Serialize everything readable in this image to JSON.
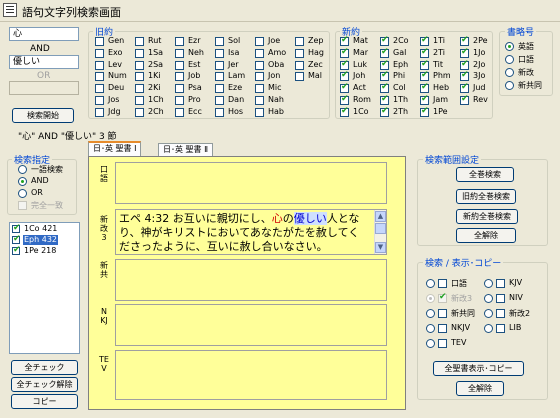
{
  "window": {
    "title": "語句文字列検索画面"
  },
  "search": {
    "term1": "心",
    "op1": "AND",
    "term2": "優しい",
    "op2": "OR",
    "term3": "",
    "start_button": "検索開始",
    "result_summary": "\"心\" AND \"優しい\" 3 節"
  },
  "old_testament": {
    "title": "旧約",
    "columns": [
      [
        {
          "label": "Gen",
          "checked": false
        },
        {
          "label": "Exo",
          "checked": false
        },
        {
          "label": "Lev",
          "checked": false
        },
        {
          "label": "Num",
          "checked": false
        },
        {
          "label": "Deu",
          "checked": false
        },
        {
          "label": "Jos",
          "checked": false
        },
        {
          "label": "Jdg",
          "checked": false
        }
      ],
      [
        {
          "label": "Rut",
          "checked": false
        },
        {
          "label": "1Sa",
          "checked": false
        },
        {
          "label": "2Sa",
          "checked": false
        },
        {
          "label": "1Ki",
          "checked": false
        },
        {
          "label": "2Ki",
          "checked": false
        },
        {
          "label": "1Ch",
          "checked": false
        },
        {
          "label": "2Ch",
          "checked": false
        }
      ],
      [
        {
          "label": "Ezr",
          "checked": false
        },
        {
          "label": "Neh",
          "checked": false
        },
        {
          "label": "Est",
          "checked": false
        },
        {
          "label": "Job",
          "checked": false
        },
        {
          "label": "Psa",
          "checked": false
        },
        {
          "label": "Pro",
          "checked": false
        },
        {
          "label": "Ecc",
          "checked": false
        }
      ],
      [
        {
          "label": "Sol",
          "checked": false
        },
        {
          "label": "Isa",
          "checked": false
        },
        {
          "label": "Jer",
          "checked": false
        },
        {
          "label": "Lam",
          "checked": false
        },
        {
          "label": "Eze",
          "checked": false
        },
        {
          "label": "Dan",
          "checked": false
        },
        {
          "label": "Hos",
          "checked": false
        }
      ],
      [
        {
          "label": "Joe",
          "checked": false
        },
        {
          "label": "Amo",
          "checked": false
        },
        {
          "label": "Oba",
          "checked": false
        },
        {
          "label": "Jon",
          "checked": false
        },
        {
          "label": "Mic",
          "checked": false
        },
        {
          "label": "Nah",
          "checked": false
        },
        {
          "label": "Hab",
          "checked": false
        }
      ],
      [
        {
          "label": "Zep",
          "checked": false
        },
        {
          "label": "Hag",
          "checked": false
        },
        {
          "label": "Zec",
          "checked": false
        },
        {
          "label": "Mal",
          "checked": false
        }
      ]
    ]
  },
  "new_testament": {
    "title": "新約",
    "columns": [
      [
        {
          "label": "Mat",
          "checked": true
        },
        {
          "label": "Mar",
          "checked": true
        },
        {
          "label": "Luk",
          "checked": true
        },
        {
          "label": "Joh",
          "checked": true
        },
        {
          "label": "Act",
          "checked": true
        },
        {
          "label": "Rom",
          "checked": true
        },
        {
          "label": "1Co",
          "checked": true
        }
      ],
      [
        {
          "label": "2Co",
          "checked": true
        },
        {
          "label": "Gal",
          "checked": true
        },
        {
          "label": "Eph",
          "checked": true
        },
        {
          "label": "Phi",
          "checked": true
        },
        {
          "label": "Col",
          "checked": true
        },
        {
          "label": "1Th",
          "checked": true
        },
        {
          "label": "2Th",
          "checked": true
        }
      ],
      [
        {
          "label": "1Ti",
          "checked": true
        },
        {
          "label": "2Ti",
          "checked": true
        },
        {
          "label": "Tit",
          "checked": true
        },
        {
          "label": "Phm",
          "checked": true
        },
        {
          "label": "Heb",
          "checked": true
        },
        {
          "label": "Jam",
          "checked": true
        },
        {
          "label": "1Pe",
          "checked": true
        }
      ],
      [
        {
          "label": "2Pe",
          "checked": true
        },
        {
          "label": "1Jo",
          "checked": true
        },
        {
          "label": "2Jo",
          "checked": true
        },
        {
          "label": "3Jo",
          "checked": true
        },
        {
          "label": "Jud",
          "checked": true
        },
        {
          "label": "Rev",
          "checked": true
        }
      ]
    ]
  },
  "book_names": {
    "title": "書略号",
    "options": [
      {
        "label": "英語",
        "selected": true
      },
      {
        "label": "口語",
        "selected": false
      },
      {
        "label": "新改",
        "selected": false
      },
      {
        "label": "新共同",
        "selected": false
      }
    ]
  },
  "search_mode": {
    "title": "検索指定",
    "options": [
      {
        "label": "一語検索",
        "selected": false
      },
      {
        "label": "AND",
        "selected": true
      },
      {
        "label": "OR",
        "selected": false
      }
    ],
    "exact_match_label": "完全一致"
  },
  "results": [
    {
      "label": "1Co 421",
      "checked": true,
      "selected": false
    },
    {
      "label": "Eph 432",
      "checked": true,
      "selected": true
    },
    {
      "label": "1Pe 218",
      "checked": true,
      "selected": false
    }
  ],
  "left_buttons": {
    "check_all": "全チェック",
    "uncheck_all": "全チェック解除",
    "copy": "コピー"
  },
  "tabs": [
    {
      "label": "日･英 聖書 Ⅰ",
      "active": true
    },
    {
      "label": "日･英 聖書 Ⅱ",
      "active": false
    }
  ],
  "versions": [
    {
      "label": "口語",
      "text": ""
    },
    {
      "label": "新改3",
      "text_prefix": "エペ 4:32 お互いに親切にし、",
      "text_kokoro": "心",
      "text_mid": "の",
      "text_yasashii": "優しい",
      "text_rest": "人となり、神がキリストにおいてあなたがたを赦してくださったように、互いに赦し合いなさい。"
    },
    {
      "label": "新共",
      "text": ""
    },
    {
      "label": "NKJ",
      "text": ""
    },
    {
      "label": "TEV",
      "text": ""
    }
  ],
  "range": {
    "title": "検索範囲設定",
    "buttons": [
      "全巻検索",
      "旧約全巻検索",
      "新約全巻検索",
      "全解除"
    ]
  },
  "display": {
    "title": "検索 / 表示･コピー",
    "left": [
      {
        "label": "口語",
        "radio": false,
        "checked": false,
        "disabled": false
      },
      {
        "label": "新改3",
        "radio": true,
        "checked": true,
        "disabled": true
      },
      {
        "label": "新共同",
        "radio": false,
        "checked": false,
        "disabled": false
      },
      {
        "label": "NKJV",
        "radio": false,
        "checked": false,
        "disabled": false
      },
      {
        "label": "TEV",
        "radio": false,
        "checked": false,
        "disabled": false
      }
    ],
    "right": [
      {
        "label": "KJV"
      },
      {
        "label": "NIV"
      },
      {
        "label": "新改2"
      },
      {
        "label": "LIB"
      }
    ],
    "show_copy_button": "全聖書表示･コピー",
    "clear_button": "全解除"
  }
}
